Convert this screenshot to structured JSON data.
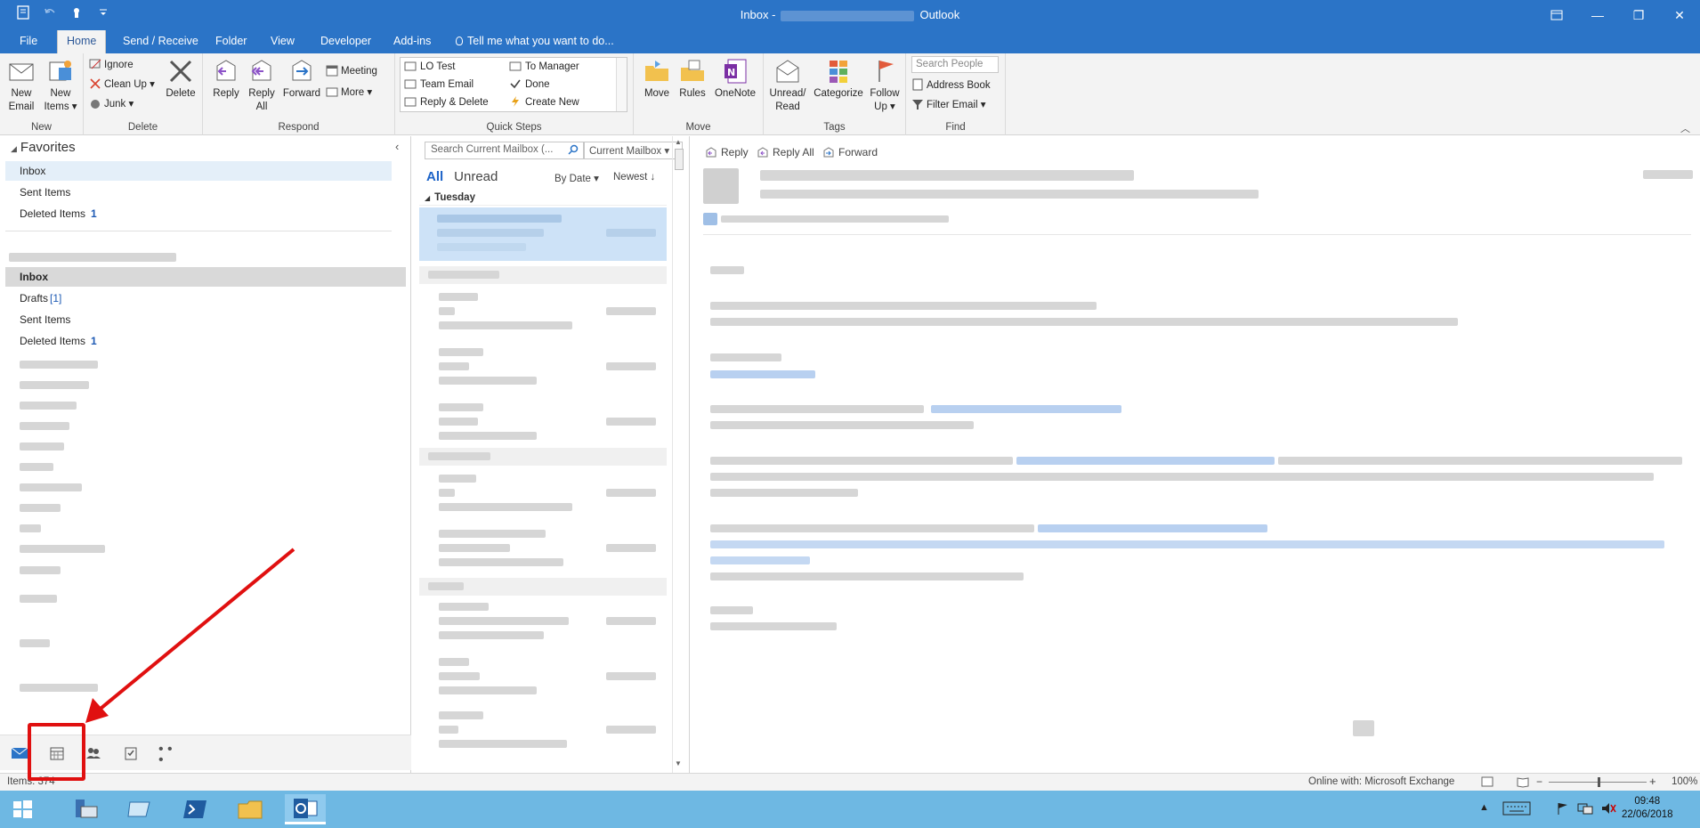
{
  "window": {
    "title_left": "Inbox -",
    "title_right": "Outlook",
    "minimize": "—",
    "restore": "❐",
    "close": "✕"
  },
  "tabs": [
    {
      "label": "File"
    },
    {
      "label": "Home"
    },
    {
      "label": "Send / Receive"
    },
    {
      "label": "Folder"
    },
    {
      "label": "View"
    },
    {
      "label": "Developer"
    },
    {
      "label": "Add-ins"
    },
    {
      "label": "Tell me what you want to do..."
    }
  ],
  "ribbon": {
    "new": {
      "label": "New",
      "new_email": "New\nEmail",
      "new_email_1": "New",
      "new_email_2": "Email",
      "new_items_1": "New",
      "new_items_2": "Items ▾"
    },
    "delete": {
      "label": "Delete",
      "ignore": "Ignore",
      "clean_up": "Clean Up ▾",
      "junk": "Junk ▾",
      "delete": "Delete"
    },
    "respond": {
      "label": "Respond",
      "reply": "Reply",
      "reply_all_1": "Reply",
      "reply_all_2": "All",
      "forward": "Forward",
      "meeting": "Meeting",
      "more": "More ▾"
    },
    "quick_steps": {
      "label": "Quick Steps",
      "lo_test": "LO Test",
      "team_email": "Team Email",
      "reply_delete": "Reply & Delete",
      "to_manager": "To Manager",
      "done": "Done",
      "create_new": "Create New"
    },
    "move": {
      "label": "Move",
      "move": "Move",
      "rules": "Rules",
      "onenote": "OneNote"
    },
    "tags": {
      "label": "Tags",
      "unread_1": "Unread/",
      "unread_2": "Read",
      "categorize": "Categorize",
      "follow_1": "Follow",
      "follow_2": "Up ▾"
    },
    "find": {
      "label": "Find",
      "search_people": "Search People",
      "address_book": "Address Book",
      "filter_email": "Filter Email ▾"
    }
  },
  "folders": {
    "favorites_header": "Favorites",
    "favorites": [
      {
        "label": "Inbox",
        "count": ""
      },
      {
        "label": "Sent Items",
        "count": ""
      },
      {
        "label": "Deleted Items",
        "count": "1"
      }
    ],
    "mailbox": [
      {
        "label": "Inbox",
        "count": ""
      },
      {
        "label": "Drafts",
        "count": "[1]"
      },
      {
        "label": "Sent Items",
        "count": ""
      },
      {
        "label": "Deleted Items",
        "count": "1"
      }
    ]
  },
  "message_list": {
    "search_placeholder": "Search Current Mailbox (...",
    "scope": "Current Mailbox ▾",
    "filter_all": "All",
    "filter_unread": "Unread",
    "sort_by": "By Date ▾",
    "order": "Newest ↓",
    "group_tuesday": "Tuesday"
  },
  "reading_pane": {
    "reply": "Reply",
    "reply_all": "Reply All",
    "forward": "Forward"
  },
  "status": {
    "items": "Items: 374",
    "connection": "Online with: Microsoft Exchange",
    "zoom": "100%"
  },
  "taskbar": {
    "time": "09:48",
    "date": "22/06/2018"
  },
  "colors": {
    "accent": "#2b74c7",
    "annotation": "#e01010"
  }
}
